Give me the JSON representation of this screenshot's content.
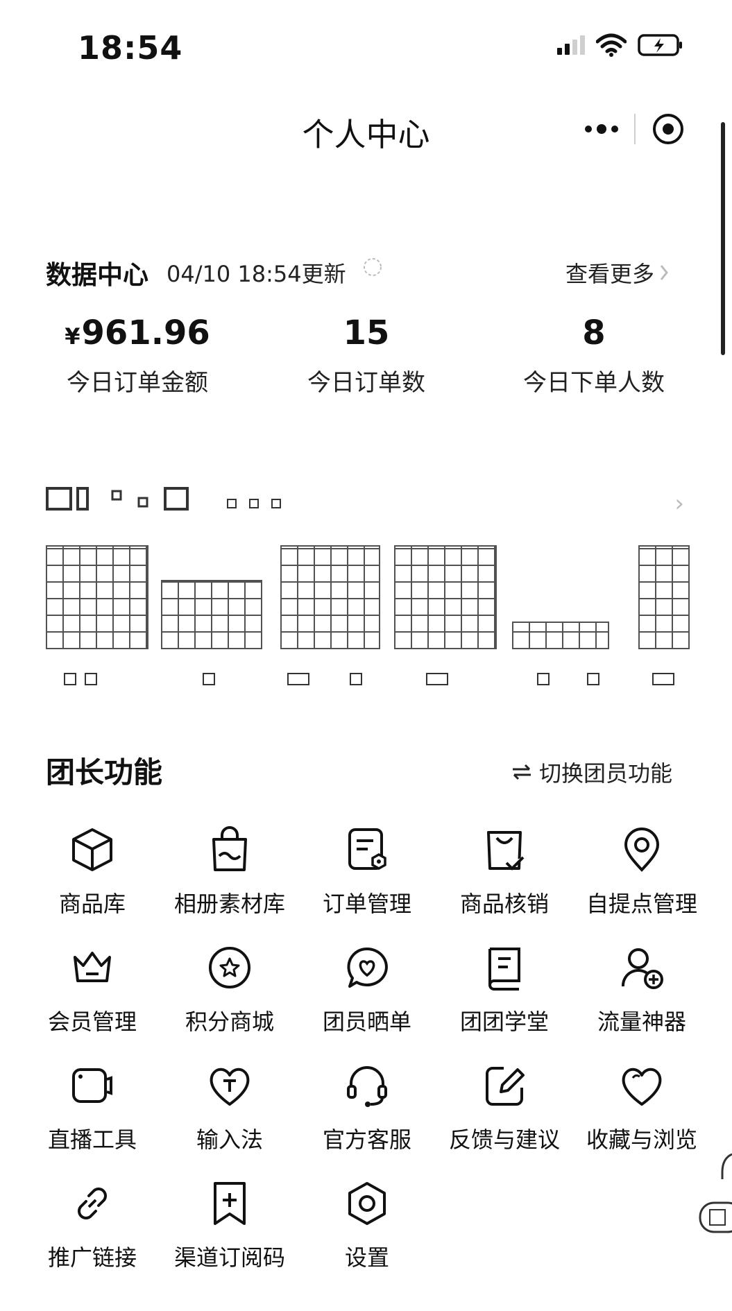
{
  "status_bar": {
    "time": "18:54"
  },
  "header": {
    "title": "个人中心"
  },
  "data_center": {
    "title": "数据中心",
    "updated": "04/10 18:54更新",
    "more": "查看更多",
    "stats": [
      {
        "currency": "¥",
        "value": "961.96",
        "label": "今日订单金额"
      },
      {
        "currency": "",
        "value": "15",
        "label": "今日订单数"
      },
      {
        "currency": "",
        "value": "8",
        "label": "今日下单人数"
      }
    ]
  },
  "leader": {
    "title": "团长功能",
    "switch_label": "切换团员功能",
    "items": [
      {
        "label": "商品库",
        "icon": "box-icon"
      },
      {
        "label": "相册素材库",
        "icon": "shopping-bag-icon"
      },
      {
        "label": "订单管理",
        "icon": "order-doc-icon"
      },
      {
        "label": "商品核销",
        "icon": "bag-check-icon"
      },
      {
        "label": "自提点管理",
        "icon": "location-pin-icon"
      },
      {
        "label": "会员管理",
        "icon": "crown-icon"
      },
      {
        "label": "积分商城",
        "icon": "star-circle-icon"
      },
      {
        "label": "团员晒单",
        "icon": "heart-bubble-icon"
      },
      {
        "label": "团团学堂",
        "icon": "book-icon"
      },
      {
        "label": "流量神器",
        "icon": "user-add-icon"
      },
      {
        "label": "直播工具",
        "icon": "camera-icon"
      },
      {
        "label": "输入法",
        "icon": "heart-t-icon"
      },
      {
        "label": "官方客服",
        "icon": "headset-icon"
      },
      {
        "label": "反馈与建议",
        "icon": "edit-icon"
      },
      {
        "label": "收藏与浏览",
        "icon": "heart-icon"
      },
      {
        "label": "推广链接",
        "icon": "link-icon"
      },
      {
        "label": "渠道订阅码",
        "icon": "bookmark-plus-icon"
      },
      {
        "label": "设置",
        "icon": "settings-hex-icon"
      }
    ]
  }
}
